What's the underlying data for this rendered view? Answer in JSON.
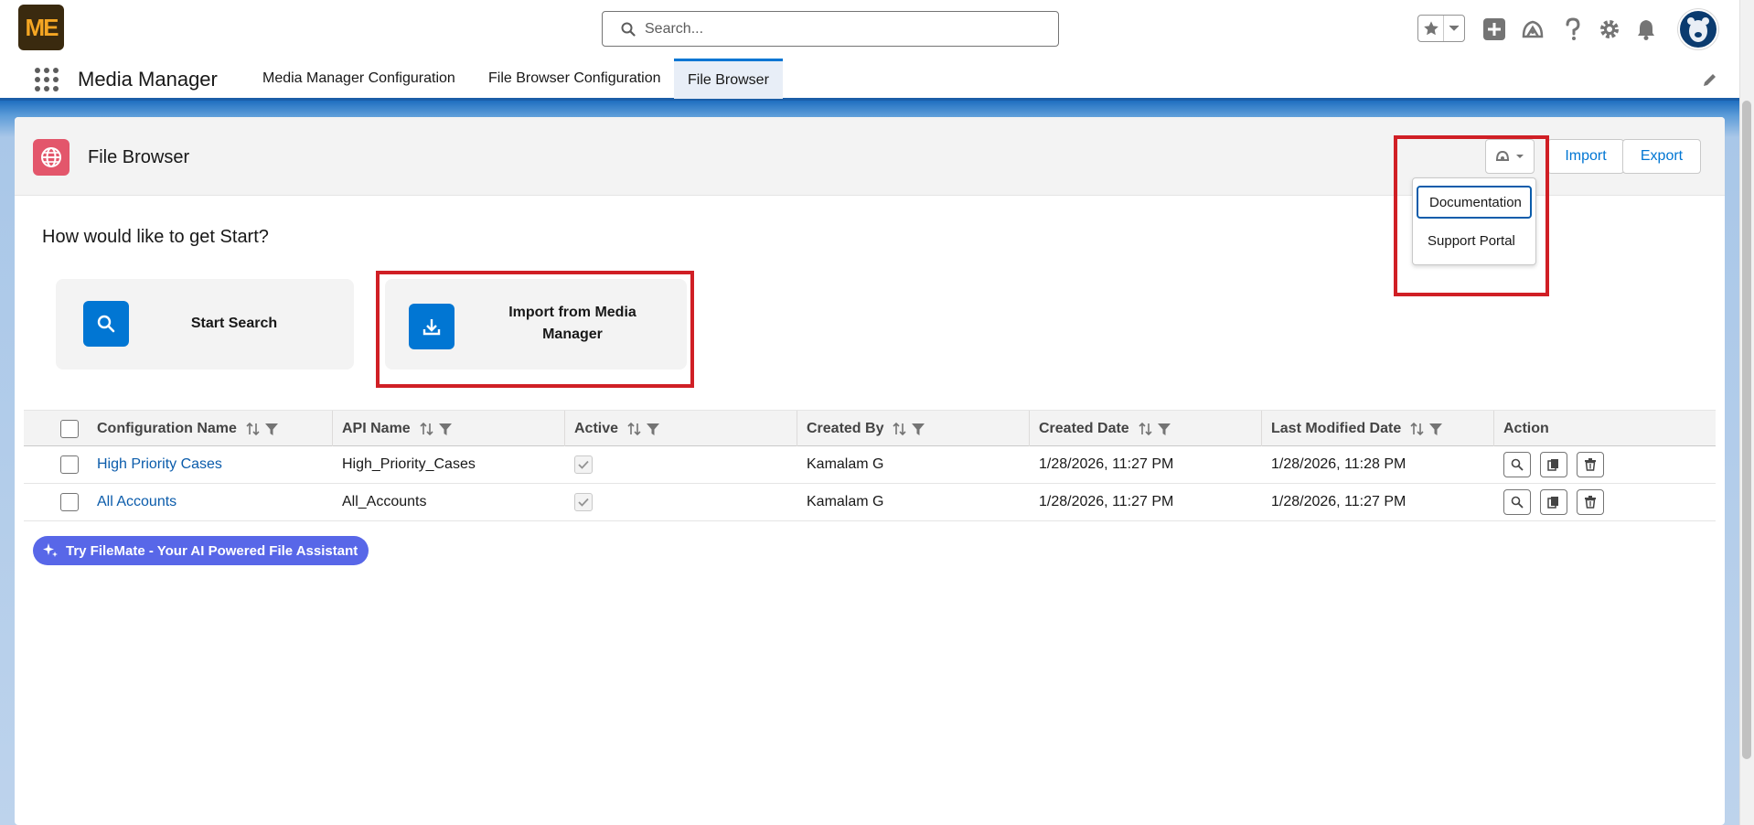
{
  "header": {
    "logo_text": "ME",
    "search_placeholder": "Search...",
    "icons": [
      "star-icon",
      "chevron-down-icon",
      "add-icon",
      "trailhead-icon",
      "help-icon",
      "setup-gear-icon",
      "bell-icon",
      "avatar"
    ]
  },
  "app_nav": {
    "app_name": "Media Manager",
    "tabs": [
      {
        "label": "Media Manager Configuration"
      },
      {
        "label": "File Browser Configuration"
      },
      {
        "label": "File Browser"
      }
    ],
    "active_tab": "File Browser"
  },
  "page": {
    "title": "File Browser",
    "import_label": "Import",
    "export_label": "Export",
    "help_menu": {
      "items": [
        {
          "label": "Documentation"
        },
        {
          "label": "Support Portal"
        }
      ]
    },
    "prompt": "How would like to get Start?",
    "cards": {
      "start_search": "Start Search",
      "import_media_line1": "Import from Media",
      "import_media_line2": "Manager"
    }
  },
  "table": {
    "columns": [
      {
        "label": "Configuration Name"
      },
      {
        "label": "API Name"
      },
      {
        "label": "Active"
      },
      {
        "label": "Created By"
      },
      {
        "label": "Created Date"
      },
      {
        "label": "Last Modified Date"
      },
      {
        "label": "Action"
      }
    ],
    "rows": [
      {
        "name": "High Priority Cases",
        "api_name": "High_Priority_Cases",
        "active": true,
        "created_by": "Kamalam G",
        "created_date": "1/28/2026, 11:27 PM",
        "modified_date": "1/28/2026, 11:28 PM"
      },
      {
        "name": "All Accounts",
        "api_name": "All_Accounts",
        "active": true,
        "created_by": "Kamalam G",
        "created_date": "1/28/2026, 11:27 PM",
        "modified_date": "1/28/2026, 11:27 PM"
      }
    ]
  },
  "filemate": {
    "label": "Try FileMate - Your AI Powered File Assistant"
  },
  "colors": {
    "brand_blue": "#0176d3",
    "highlight_red": "#d01f25",
    "page_icon_pink": "#e3566b",
    "filemate_purple": "#5867e8"
  }
}
